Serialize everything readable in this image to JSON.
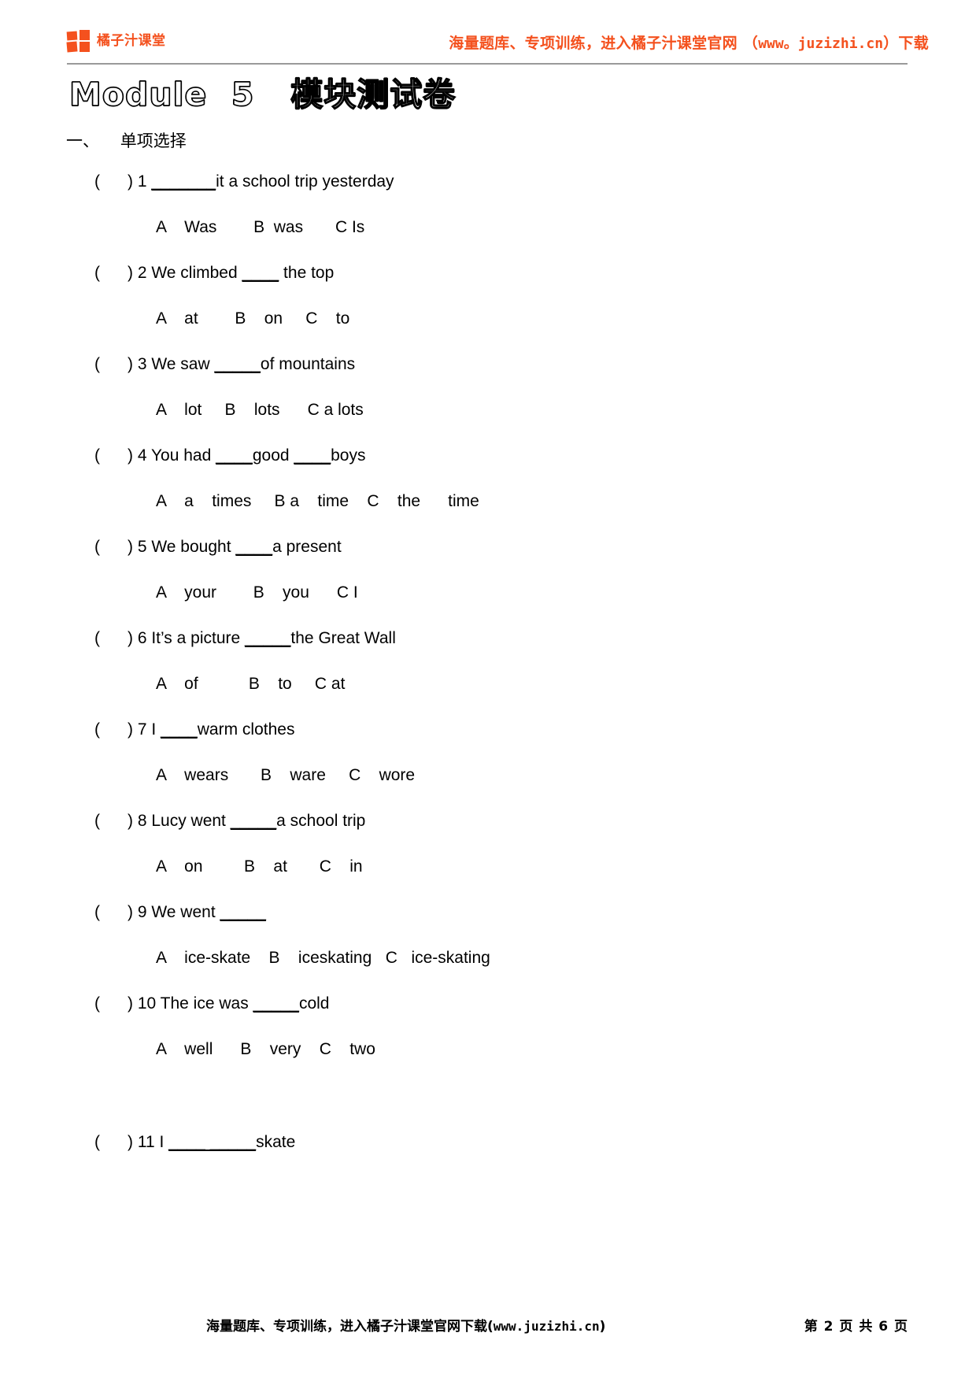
{
  "header": {
    "brand_name": "橘子汁课堂",
    "logo_icon": "four-square-logo-icon",
    "promo_text": "海量题库、专项训练，进入橘子汁课堂官网 （",
    "promo_url": "www。juzizhi.cn",
    "promo_tail": "）下载",
    "accent_color": "#F4511E"
  },
  "title": "Module  5   模块测试卷",
  "section": "一、    单项选择",
  "questions": [
    {
      "marker": "(      ) 1 ",
      "blank": "_______",
      "stem_tail": "it a school trip yesterday",
      "options": "A    Was        B  was       C Is"
    },
    {
      "marker": "(      ) 2 ",
      "stem_head": "We climbed ",
      "blank": "____",
      "stem_tail": " the top",
      "options": "A    at        B    on     C    to"
    },
    {
      "marker": "(      ) 3 ",
      "stem_head": "We saw ",
      "blank": "_____",
      "stem_tail": "of mountains",
      "options": "A    lot     B    lots      C a lots"
    },
    {
      "marker": "(      ) 4 ",
      "stem_head": "You had ",
      "blank": "____",
      "stem_mid": "good ",
      "blank2": "____",
      "stem_tail": "boys",
      "options": "A    a    times     B a    time    C    the      time"
    },
    {
      "marker": "(      ) 5 ",
      "stem_head": "We bought ",
      "blank": "____",
      "stem_tail": "a present",
      "options": "A    your        B    you      C I"
    },
    {
      "marker": "(      ) 6 ",
      "stem_head": "It’s a picture ",
      "blank": "_____",
      "stem_tail": "the Great Wall",
      "options": "A    of           B    to     C at"
    },
    {
      "marker": "(      ) 7 ",
      "stem_head": "I ",
      "blank": "____",
      "stem_tail": "warm clothes",
      "options": "A    wears       B    ware     C    wore"
    },
    {
      "marker": "(      ) 8 ",
      "stem_head": "Lucy went ",
      "blank": "_____",
      "stem_tail": "a school trip",
      "options": "A    on         B    at       C    in"
    },
    {
      "marker": "(      ) 9 ",
      "stem_head": "We went ",
      "blank": "_____",
      "stem_tail": "",
      "options": "A    ice-skate    B    iceskating   C   ice-skating"
    },
    {
      "marker": "(      ) 10 ",
      "stem_head": "The ice was ",
      "blank": "_____",
      "stem_tail": "cold",
      "options": "A    well      B    very    C    two"
    },
    {
      "marker": "(      ) 11 ",
      "stem_head": "I ",
      "blank": "____ _____",
      "stem_tail": "skate",
      "options": ""
    }
  ],
  "footer": {
    "center_text_pre": "海量题库、专项训练，进入橘子汁课堂官网下载(",
    "center_url": "www.juzizhi.cn",
    "center_text_post": ")",
    "page_info": "第 2 页 共 6 页"
  }
}
